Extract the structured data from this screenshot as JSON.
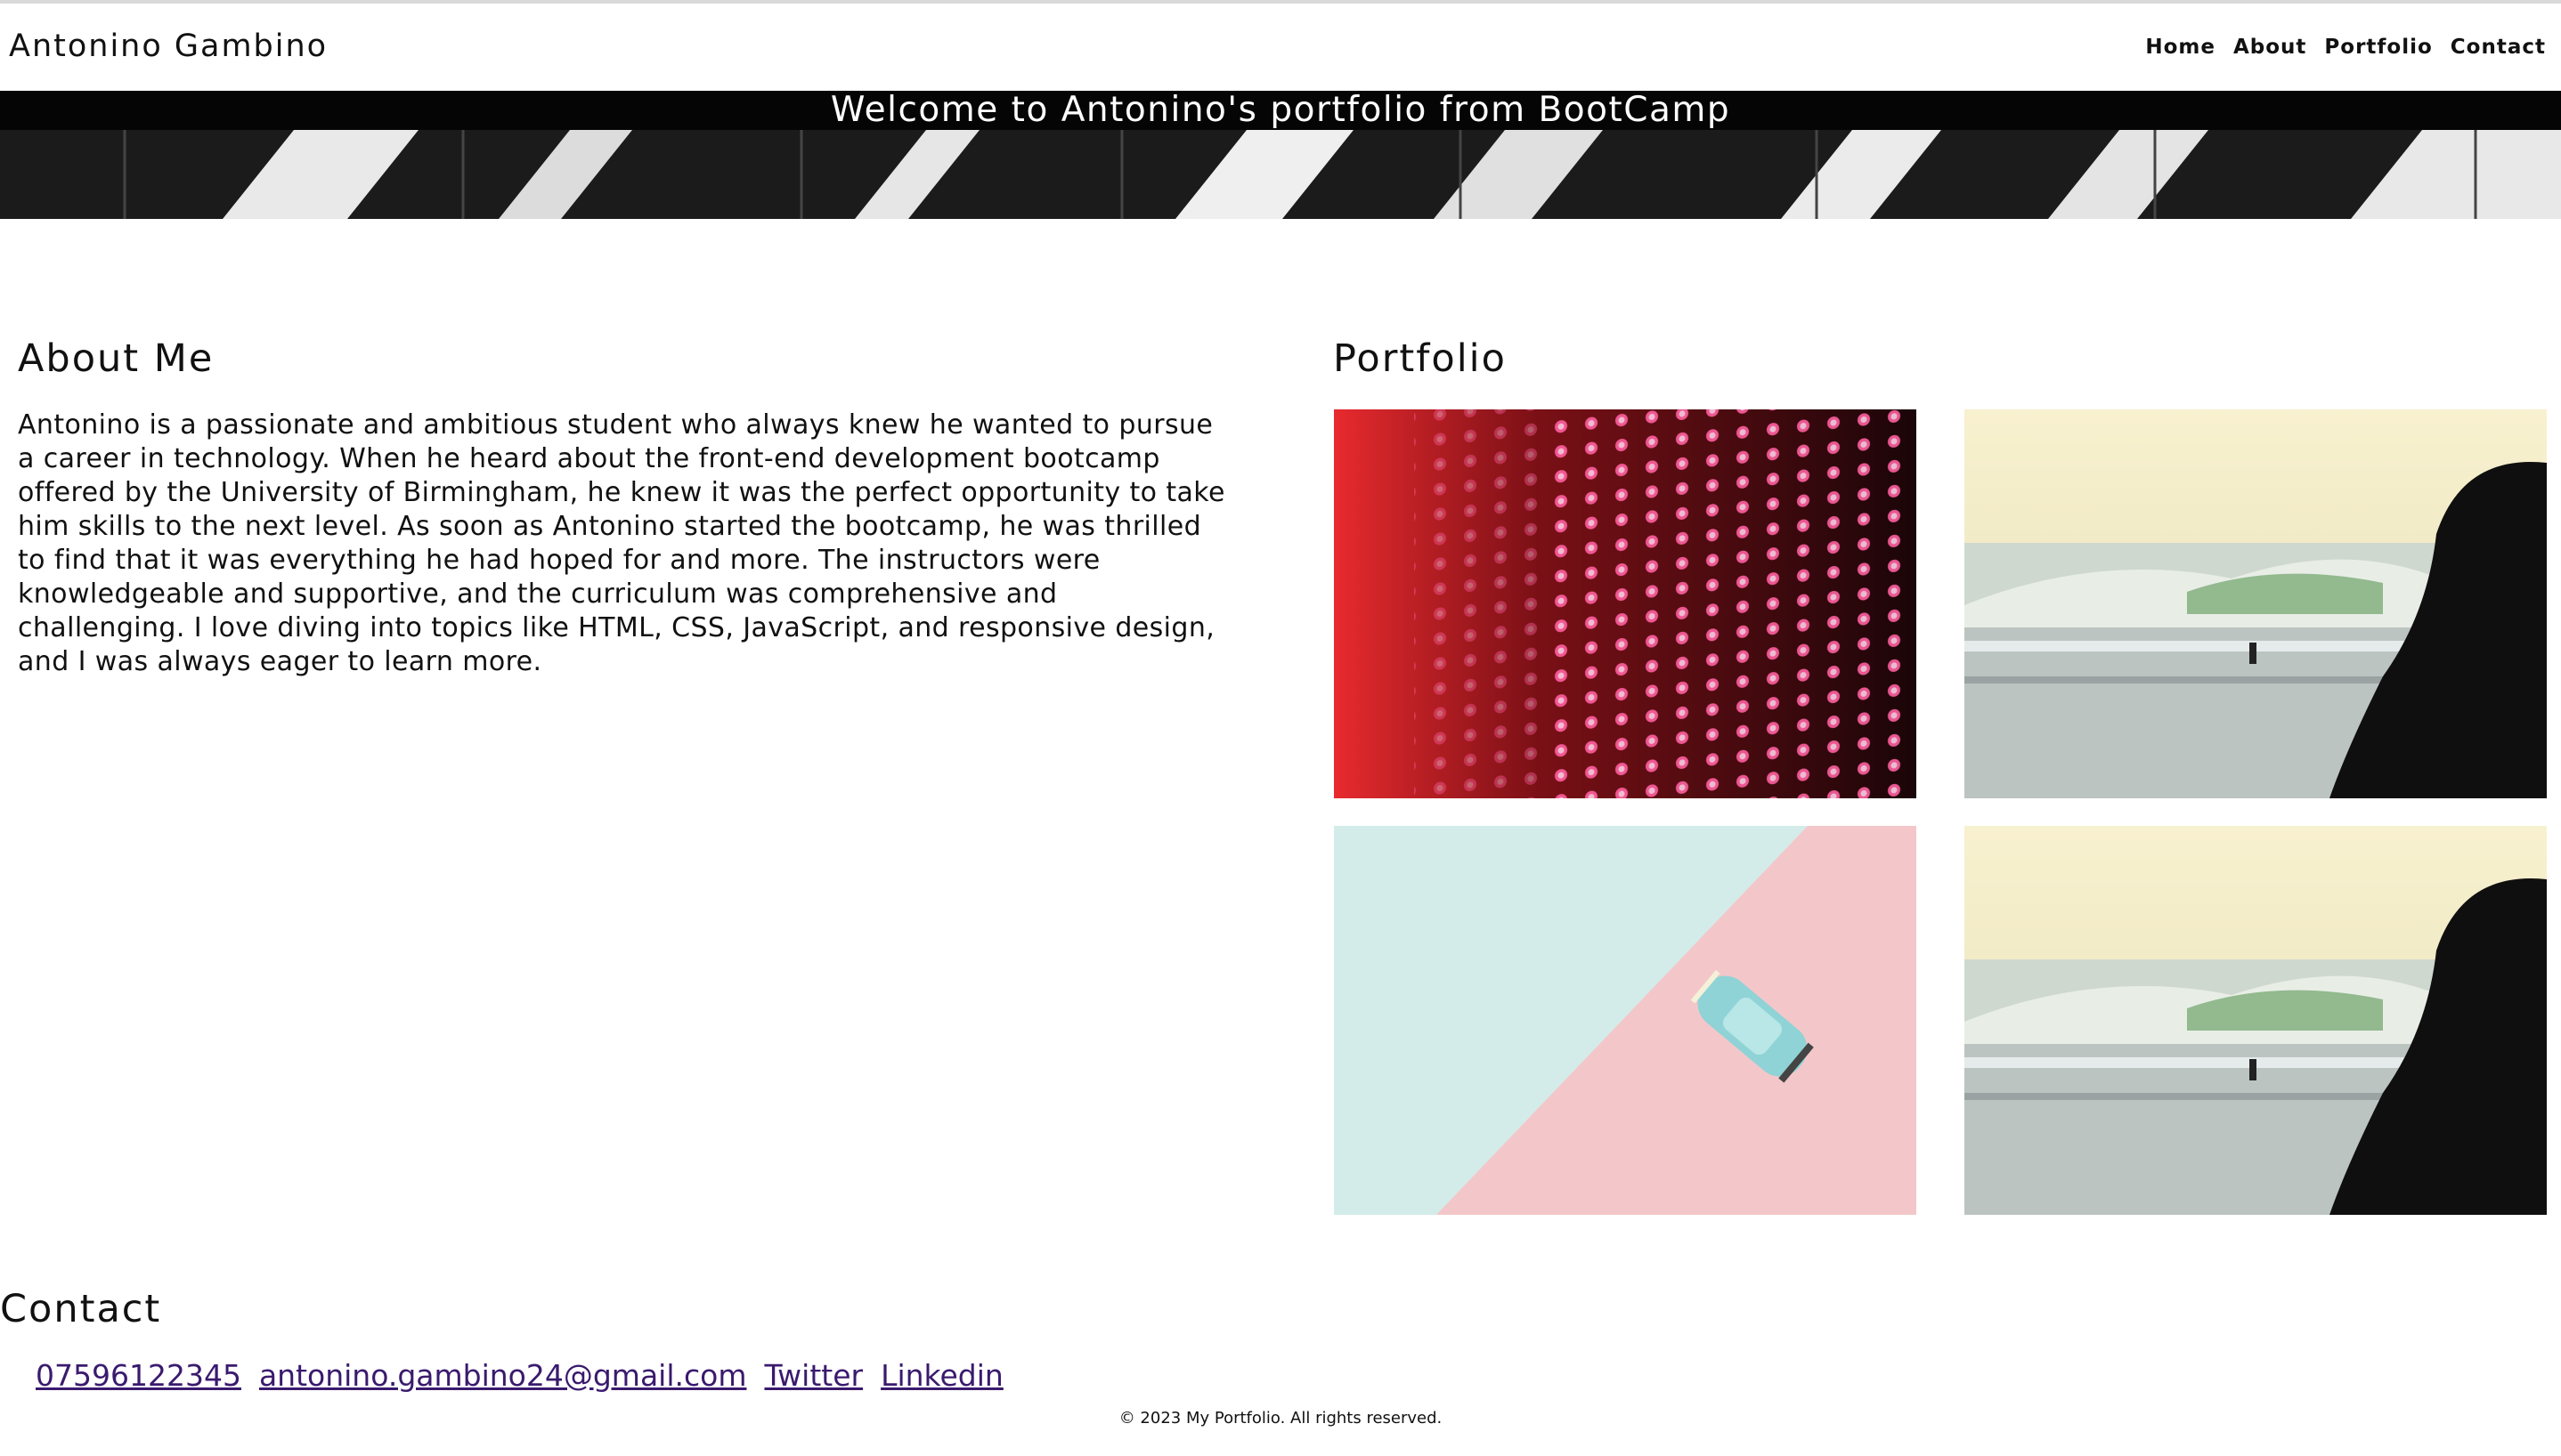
{
  "header": {
    "brand": "Antonino Gambino",
    "nav": [
      "Home",
      "About",
      "Portfolio",
      "Contact"
    ]
  },
  "hero": {
    "title": "Welcome to Antonino's portfolio from BootCamp"
  },
  "about": {
    "heading": "About Me",
    "text": "Antonino is a passionate and ambitious student who always knew he wanted to pursue a career in technology. When he heard about the front-end development bootcamp offered by the University of Birmingham, he knew it was the perfect opportunity to take him skills to the next level. As soon as Antonino started the bootcamp, he was thrilled to find that it was everything he had hoped for and more. The instructors were knowledgeable and supportive, and the curriculum was comprehensive and challenging. I love diving into topics like HTML, CSS, JavaScript, and responsive design, and I was always eager to learn more."
  },
  "portfolio": {
    "heading": "Portfolio",
    "items": [
      {
        "image": "red-led-wall"
      },
      {
        "image": "surfer-sunset"
      },
      {
        "image": "toy-car-pink-mint"
      },
      {
        "image": "surfer-sunset"
      }
    ]
  },
  "contact": {
    "heading": "Contact",
    "links": [
      "07596122345",
      "antonino.gambino24@gmail.com",
      "Twitter",
      "Linkedin"
    ]
  },
  "footer": {
    "text": "© 2023 My Portfolio. All rights reserved."
  },
  "colors": {
    "link": "#3a1a6e",
    "hero_band": "#050505",
    "text": "#111111"
  }
}
